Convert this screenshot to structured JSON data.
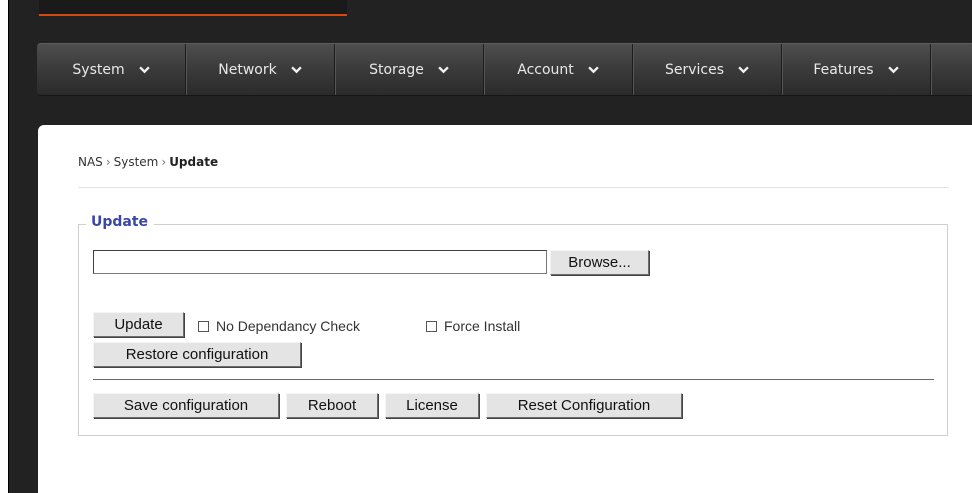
{
  "nav": {
    "items": [
      {
        "label": "System",
        "icon": "chevron-down-icon"
      },
      {
        "label": "Network",
        "icon": "chevron-down-icon"
      },
      {
        "label": "Storage",
        "icon": "chevron-down-icon"
      },
      {
        "label": "Account",
        "icon": "chevron-down-icon"
      },
      {
        "label": "Services",
        "icon": "chevron-down-icon"
      },
      {
        "label": "Features",
        "icon": "chevron-down-icon"
      }
    ]
  },
  "breadcrumb": {
    "items": [
      "NAS",
      "System"
    ],
    "separator": "›",
    "current": "Update"
  },
  "update_section": {
    "legend": "Update",
    "file_value": "",
    "browse_label": "Browse...",
    "update_label": "Update",
    "no_dependency_label": "No Dependancy Check",
    "no_dependency_checked": false,
    "force_install_label": "Force Install",
    "force_install_checked": false,
    "restore_label": "Restore configuration",
    "save_label": "Save configuration",
    "reboot_label": "Reboot",
    "license_label": "License",
    "reset_label": "Reset Configuration"
  },
  "colors": {
    "accent_orange": "#d9480f",
    "legend_blue": "#3a46a8",
    "nav_bg": "#3a3a3a",
    "frame_bg": "#222222"
  }
}
